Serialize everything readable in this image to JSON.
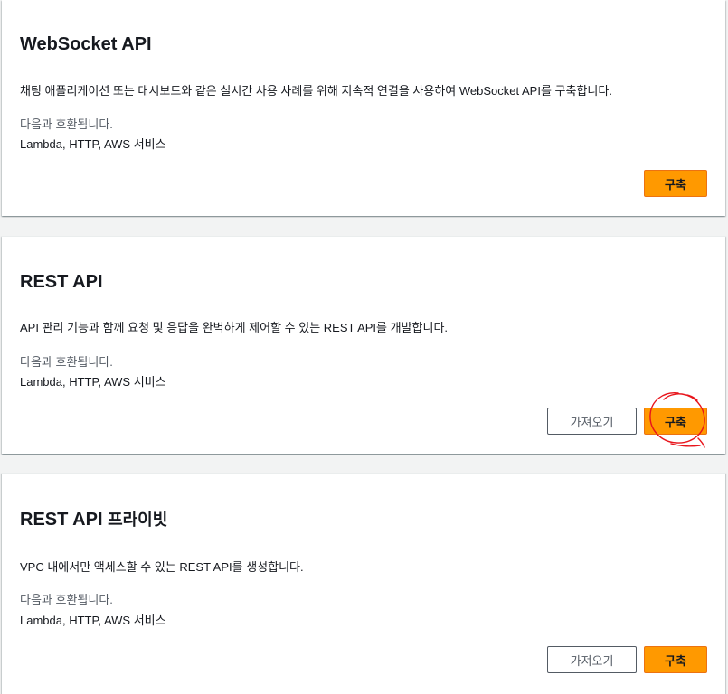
{
  "cards": {
    "websocket": {
      "title": "WebSocket API",
      "description": "채팅 애플리케이션 또는 대시보드와 같은 실시간 사용 사례를 위해 지속적 연결을 사용하여 WebSocket API를 구축합니다.",
      "compat_label": "다음과 호환됩니다.",
      "compat_value": "Lambda, HTTP, AWS 서비스",
      "build_label": "구축"
    },
    "rest": {
      "title": "REST API",
      "description": "API 관리 기능과 함께 요청 및 응답을 완벽하게 제어할 수 있는 REST API를 개발합니다.",
      "compat_label": "다음과 호환됩니다.",
      "compat_value": "Lambda, HTTP, AWS 서비스",
      "import_label": "가져오기",
      "build_label": "구축"
    },
    "rest_private": {
      "title": "REST API",
      "title_suffix": "프라이빗",
      "description": "VPC 내에서만 액세스할 수 있는 REST API를 생성합니다.",
      "compat_label": "다음과 호환됩니다.",
      "compat_value": "Lambda, HTTP, AWS 서비스",
      "import_label": "가져오기",
      "build_label": "구축"
    }
  },
  "colors": {
    "primary_button": "#ff9900",
    "annotation": "#e8141b"
  },
  "annotation": {
    "shape": "red hand-drawn circle around REST API build button"
  }
}
